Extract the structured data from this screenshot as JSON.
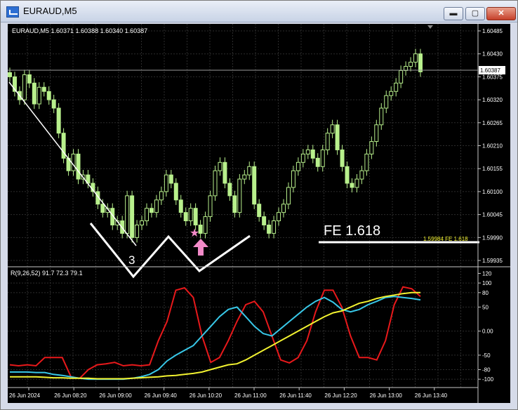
{
  "window": {
    "title": "EURAUD,M5",
    "controls": {
      "minimize": "▬",
      "maximize": "▢",
      "close": "✕"
    }
  },
  "chart": {
    "header": "EURAUD,M5  1.60371 1.60388 1.60340 1.60387",
    "price_ticks": [
      "1.60485",
      "1.60430",
      "1.60375",
      "1.60320",
      "1.60265",
      "1.60210",
      "1.60155",
      "1.60100",
      "1.60045",
      "1.59990",
      "1.59935"
    ],
    "current_price": "1.60387",
    "fe_label": "FE 1.618",
    "fe_price_label": "1.59984  FE 1.618",
    "wave_label": "3",
    "indicator_header": "R(9,26,52) 91.7 72.3 79.1",
    "indicator_ticks": [
      "120",
      "100",
      "80",
      "50",
      "0.00",
      "-50",
      "-80",
      "-100"
    ],
    "time_labels": [
      "26 Jun 2024",
      "26 Jun 08:20",
      "26 Jun 09:00",
      "26 Jun 09:40",
      "26 Jun 10:20",
      "26 Jun 11:00",
      "26 Jun 11:40",
      "26 Jun 12:20",
      "26 Jun 13:00",
      "26 Jun 13:40"
    ]
  },
  "chart_data": {
    "type": "candlestick",
    "symbol": "EURAUD",
    "timeframe": "M5",
    "price_ylim": [
      1.5993,
      1.60485
    ],
    "candles_close": [
      1.60375,
      1.6034,
      1.6032,
      1.6038,
      1.6036,
      1.6031,
      1.6035,
      1.6034,
      1.6032,
      1.603,
      1.6024,
      1.6018,
      1.6015,
      1.6019,
      1.6013,
      1.6014,
      1.6012,
      1.601,
      1.6007,
      1.6005,
      1.6006,
      1.6002,
      1.6003,
      1.6,
      1.6009,
      1.5999,
      1.6002,
      1.6003,
      1.6006,
      1.6005,
      1.6008,
      1.601,
      1.6014,
      1.6012,
      1.6008,
      1.6005,
      1.6003,
      1.6006,
      1.6002,
      1.6,
      1.6004,
      1.6009,
      1.6015,
      1.6017,
      1.6012,
      1.6009,
      1.6005,
      1.6013,
      1.6014,
      1.6016,
      1.6007,
      1.6004,
      1.6002,
      1.6,
      1.6003,
      1.6005,
      1.6007,
      1.6011,
      1.6015,
      1.6017,
      1.6019,
      1.602,
      1.6018,
      1.6016,
      1.602,
      1.6024,
      1.6026,
      1.602,
      1.6016,
      1.6012,
      1.6011,
      1.6013,
      1.6015,
      1.6019,
      1.6022,
      1.6026,
      1.603,
      1.6033,
      1.6034,
      1.6036,
      1.6039,
      1.604,
      1.6041,
      1.6043,
      1.60387
    ],
    "indicator": {
      "name": "R(9,26,52)",
      "ylim": [
        -110,
        125
      ],
      "series": [
        {
          "name": "R9",
          "color": "#e8191b",
          "values": [
            -70,
            -72,
            -70,
            -72,
            -55,
            -55,
            -55,
            -95,
            -98,
            -80,
            -70,
            -68,
            -65,
            -72,
            -70,
            -72,
            -70,
            -20,
            20,
            85,
            90,
            70,
            -10,
            -65,
            -55,
            -20,
            20,
            55,
            62,
            40,
            -10,
            -60,
            -66,
            -55,
            -20,
            40,
            85,
            85,
            50,
            -10,
            -55,
            -55,
            -60,
            -20,
            55,
            92,
            88,
            72
          ],
          "values_note": ""
        },
        {
          "name": "R26",
          "color": "#38c8e8",
          "values": [
            -85,
            -85,
            -85,
            -86,
            -86,
            -90,
            -92,
            -95,
            -98,
            -100,
            -100,
            -100,
            -100,
            -100,
            -98,
            -95,
            -90,
            -80,
            -62,
            -50,
            -40,
            -30,
            -10,
            10,
            30,
            45,
            50,
            30,
            10,
            -5,
            -10,
            5,
            20,
            35,
            50,
            62,
            70,
            60,
            45,
            40,
            45,
            55,
            62,
            70,
            72,
            70,
            68,
            65
          ],
          "values_note": ""
        },
        {
          "name": "R52",
          "color": "#f2f230",
          "values": [
            -95,
            -95,
            -95,
            -95,
            -96,
            -97,
            -97,
            -98,
            -98,
            -98,
            -99,
            -99,
            -99,
            -99,
            -98,
            -97,
            -96,
            -95,
            -93,
            -92,
            -90,
            -88,
            -85,
            -80,
            -75,
            -70,
            -68,
            -60,
            -50,
            -40,
            -30,
            -20,
            -10,
            0,
            10,
            20,
            30,
            38,
            42,
            50,
            58,
            62,
            68,
            72,
            75,
            78,
            80,
            80
          ],
          "values_note": ""
        }
      ]
    }
  },
  "colors": {
    "background": "#000000",
    "grid": "#2c2c2c",
    "candle": "#b8f08c",
    "trendline": "#ffffff",
    "fe_line": "#ffffff",
    "fe_price": "#f2f230",
    "star": "#f28ac8",
    "arrow": "#f28ac8"
  }
}
